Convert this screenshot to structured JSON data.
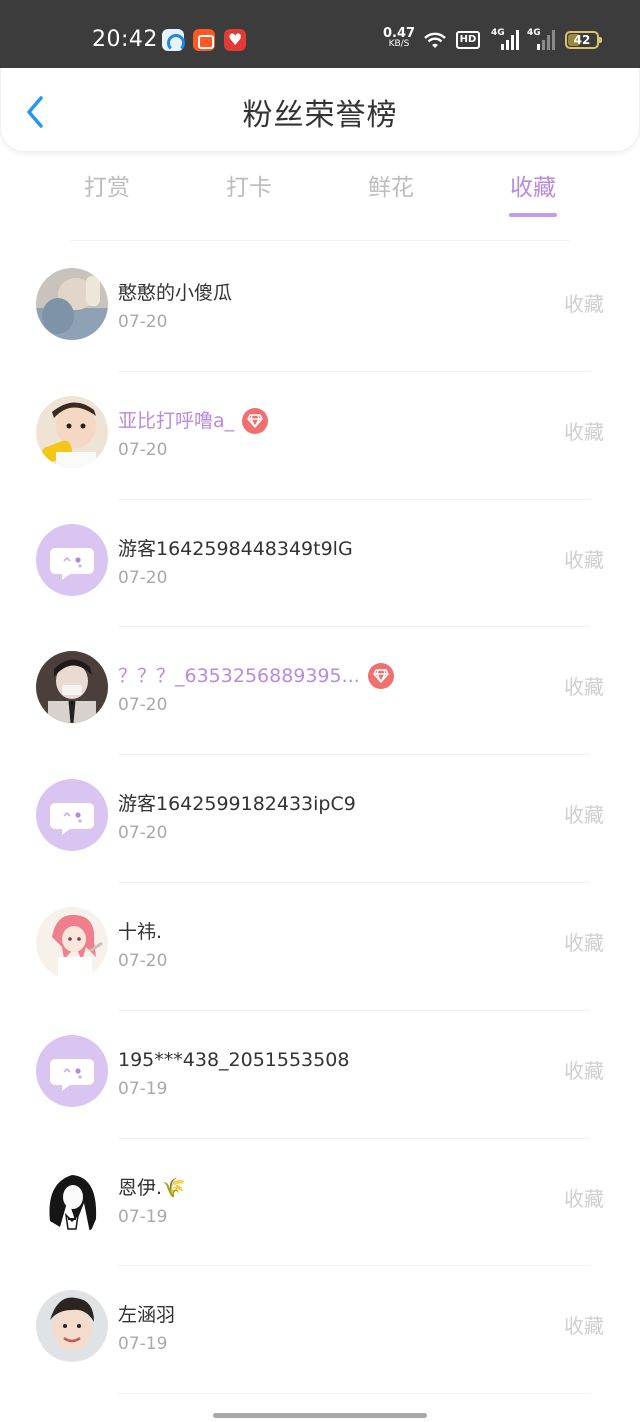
{
  "status_bar": {
    "time": "20:42",
    "net_speed": "0.47",
    "net_unit": "KB/S",
    "hd_label": "HD",
    "network_1": "4G",
    "network_2": "4G",
    "battery": "42",
    "battery_level": 0.42,
    "app_icons": [
      "browser-icon",
      "app-icon",
      "heart-app-icon"
    ]
  },
  "header": {
    "title": "粉丝荣誉榜",
    "back_icon": "chevron-left-icon"
  },
  "tabs": [
    {
      "label": "打赏",
      "active": false
    },
    {
      "label": "打卡",
      "active": false
    },
    {
      "label": "鲜花",
      "active": false
    },
    {
      "label": "收藏",
      "active": true
    }
  ],
  "list": [
    {
      "name": "憨憨的小傻瓜",
      "date": "07-20",
      "action": "收藏",
      "vip": false,
      "avatar": "photo"
    },
    {
      "name": "亚比打呼噜a_",
      "date": "07-20",
      "action": "收藏",
      "vip": true,
      "avatar": "photo"
    },
    {
      "name": "游客1642598448349t9lG",
      "date": "07-20",
      "action": "收藏",
      "vip": false,
      "avatar": "default"
    },
    {
      "name": "？？？_6353256889395...",
      "date": "07-20",
      "action": "收藏",
      "vip": true,
      "avatar": "photo"
    },
    {
      "name": "游客1642599182433ipC9",
      "date": "07-20",
      "action": "收藏",
      "vip": false,
      "avatar": "default"
    },
    {
      "name": "十祎.",
      "date": "07-20",
      "action": "收藏",
      "vip": false,
      "avatar": "anime"
    },
    {
      "name": "195***438_2051553508",
      "date": "07-19",
      "action": "收藏",
      "vip": false,
      "avatar": "default"
    },
    {
      "name": "恩伊.🌾",
      "date": "07-19",
      "action": "收藏",
      "vip": false,
      "avatar": "sketch"
    },
    {
      "name": "左涵羽",
      "date": "07-19",
      "action": "收藏",
      "vip": false,
      "avatar": "photo"
    }
  ],
  "colors": {
    "accent": "#b98ae0",
    "status_bar": "#3c3c3c",
    "default_avatar": "#d9c4f2",
    "badge": "#f07070",
    "back_arrow": "#2196f3"
  }
}
